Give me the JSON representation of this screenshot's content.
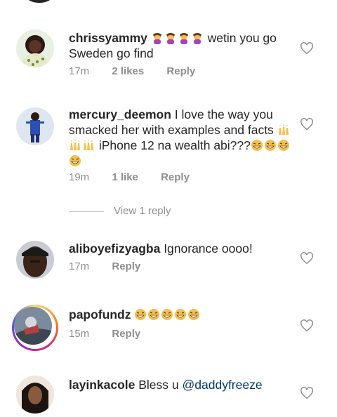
{
  "comments": [
    {
      "username": "chrissyammy",
      "text": " wetin you go Sweden go find",
      "emoji_count": 4,
      "time": "17m",
      "likes": "2 likes",
      "reply": "Reply"
    },
    {
      "username": "mercury_deemon",
      "text": " I love the way you smacked her with examples and facts",
      "text2": " iPhone 12 na wealth abi???",
      "time": "19m",
      "likes": "1 like",
      "reply": "Reply"
    },
    {
      "username": "aliboyefizyagba",
      "text": " Ignorance oooo!",
      "time": "17m",
      "reply": "Reply"
    },
    {
      "username": "papofundz",
      "text": " ",
      "time": "15m",
      "reply": "Reply"
    },
    {
      "username": "layinkacole",
      "text": " Bless u ",
      "mention": "@daddyfreeze"
    }
  ],
  "view_replies": "View 1 reply",
  "colors": {
    "text": "#262626",
    "meta": "#8e8e8e",
    "mention": "#00376b"
  },
  "icons": [
    "heart-outline-icon",
    "facepalm-emoji",
    "raised-hands-emoji",
    "laughing-emoji"
  ]
}
